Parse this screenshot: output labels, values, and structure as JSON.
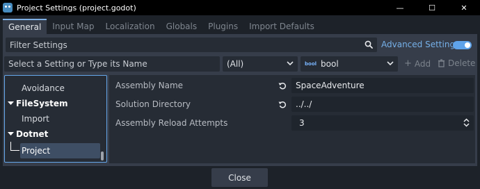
{
  "window": {
    "title": "Project Settings (project.godot)",
    "minimize_glyph": "—",
    "maximize_glyph": "☐",
    "close_glyph": "✕"
  },
  "tabs": [
    {
      "label": "General",
      "active": true
    },
    {
      "label": "Input Map"
    },
    {
      "label": "Localization"
    },
    {
      "label": "Globals"
    },
    {
      "label": "Plugins"
    },
    {
      "label": "Import Defaults"
    }
  ],
  "filter": {
    "placeholder": "Filter Settings",
    "advanced_label": "Advanced Settings",
    "advanced_enabled": true
  },
  "add_row": {
    "name_placeholder": "Select a Setting or Type its Name",
    "category_select": "(All)",
    "type_badge": "bool",
    "type_select": "bool",
    "add_label": "Add",
    "delete_label": "Delete"
  },
  "tree": {
    "items": [
      {
        "label": "Avoidance",
        "kind": "child"
      },
      {
        "label": "FileSystem",
        "kind": "category"
      },
      {
        "label": "Import",
        "kind": "child"
      },
      {
        "label": "Dotnet",
        "kind": "category"
      },
      {
        "label": "Project",
        "kind": "selected"
      }
    ]
  },
  "settings": [
    {
      "label": "Assembly Name",
      "value": "SpaceAdventure",
      "revertable": true
    },
    {
      "label": "Solution Directory",
      "value": "../../",
      "revertable": true
    },
    {
      "label": "Assembly Reload Attempts",
      "value": "3",
      "revertable": false
    }
  ],
  "footer": {
    "close_label": "Close"
  },
  "colors": {
    "accent": "#66a8ec",
    "background": "#1d2229",
    "panel": "#363d4a",
    "field": "#262c35"
  }
}
